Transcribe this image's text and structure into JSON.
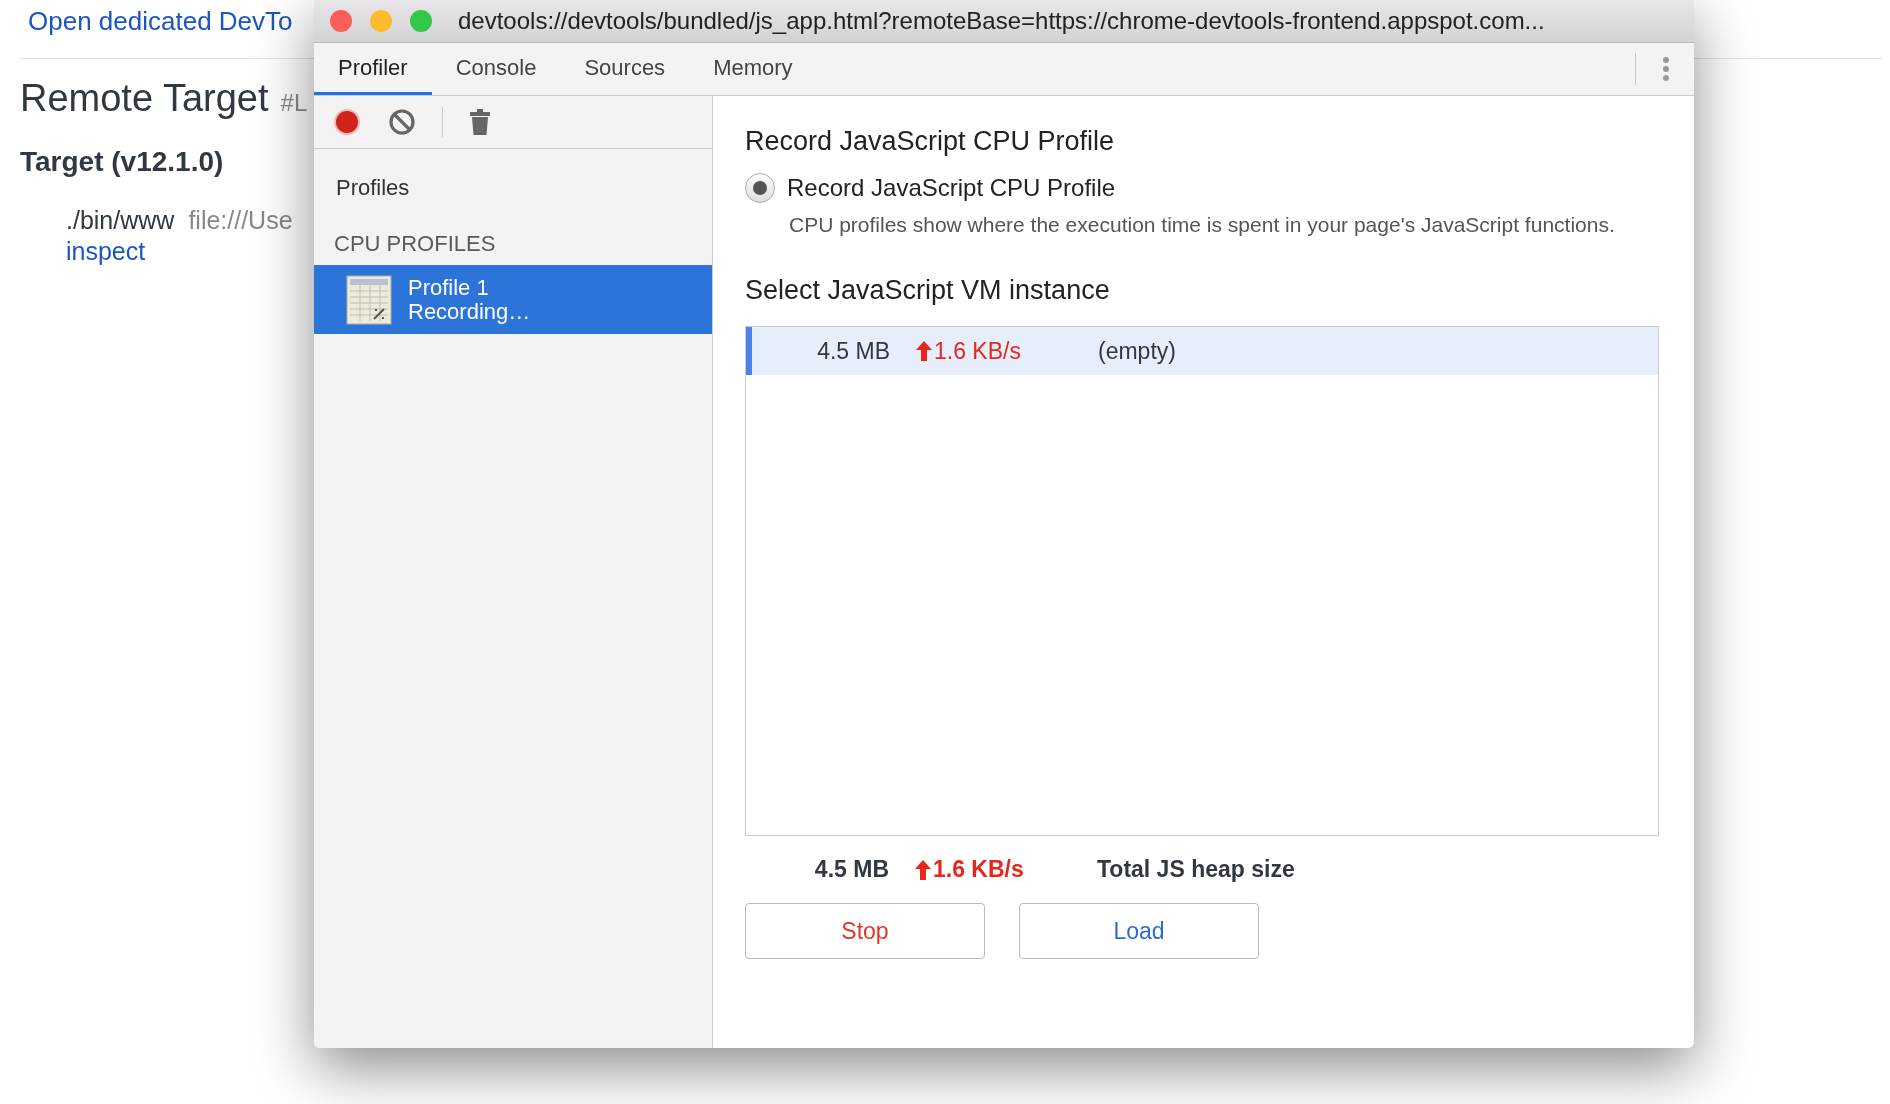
{
  "page": {
    "link": "Open dedicated DevTo",
    "title": "Remote Target",
    "title_suffix": "#L",
    "target": "Target (v12.1.0)",
    "script": "./bin/www",
    "file": "file:///Use",
    "inspect": "inspect"
  },
  "window": {
    "title": "devtools://devtools/bundled/js_app.html?remoteBase=https://chrome-devtools-frontend.appspot.com..."
  },
  "tabs": [
    {
      "label": "Profiler",
      "selected": true
    },
    {
      "label": "Console",
      "selected": false
    },
    {
      "label": "Sources",
      "selected": false
    },
    {
      "label": "Memory",
      "selected": false
    }
  ],
  "sidebar": {
    "title": "Profiles",
    "section": "CPU PROFILES",
    "items": [
      {
        "name": "Profile 1",
        "status": "Recording…",
        "selected": true
      }
    ]
  },
  "main": {
    "heading": "Record JavaScript CPU Profile",
    "radio": {
      "label": "Record JavaScript CPU Profile",
      "selected": true,
      "description": "CPU profiles show where the execution time is spent in your page's JavaScript functions."
    },
    "vm_heading": "Select JavaScript VM instance",
    "instances": [
      {
        "size": "4.5 MB",
        "rate": "1.6 KB/s",
        "name": "(empty)",
        "selected": true
      }
    ],
    "summary": {
      "size": "4.5 MB",
      "rate": "1.6 KB/s",
      "label": "Total JS heap size"
    },
    "buttons": [
      {
        "label": "Stop",
        "kind": "stop"
      },
      {
        "label": "Load",
        "kind": "load"
      }
    ]
  }
}
